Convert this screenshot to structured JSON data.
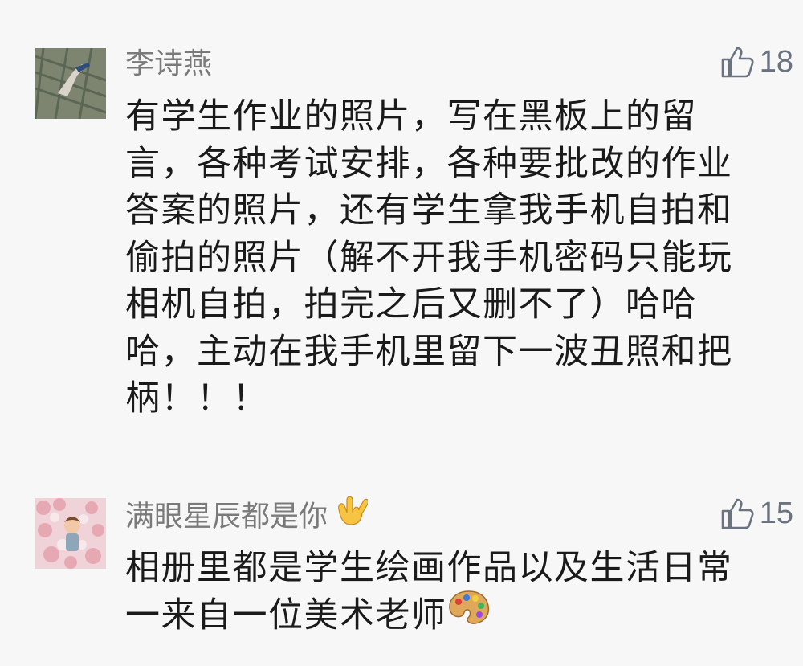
{
  "comments": [
    {
      "author": "李诗燕",
      "likes": "18",
      "text": "有学生作业的照片，写在黑板上的留言，各种考试安排，各种要批改的作业答案的照片，还有学生拿我手机自拍和偷拍的照片（解不开我手机密码只能玩相机自拍，拍完之后又删不了）哈哈哈，主动在我手机里留下一波丑照和把柄！！！",
      "icons": {
        "avatar": "avatar-photo",
        "like": "thumbs-up-icon"
      }
    },
    {
      "author": "满眼星辰都是你",
      "author_emoji": "love-you-hand-emoji",
      "likes": "15",
      "text": "相册里都是学生绘画作品以及生活日常一来自一位美术老师",
      "text_emoji": "artist-palette-emoji",
      "icons": {
        "avatar": "avatar-photo",
        "like": "thumbs-up-icon"
      }
    }
  ],
  "colors": {
    "background": "#f7f7f7",
    "author": "#7a7a7a",
    "body": "#1a1a1a",
    "like": "#6b7280"
  }
}
